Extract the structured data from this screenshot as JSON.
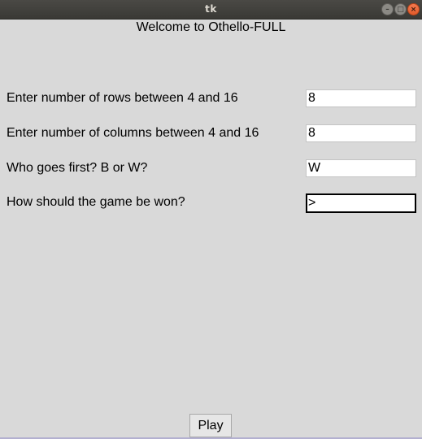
{
  "window": {
    "title": "tk",
    "controls": {
      "minimize_icon": "minimize-icon",
      "maximize_icon": "maximize-icon",
      "close_icon": "close-icon"
    }
  },
  "heading": "Welcome to Othello-FULL",
  "form": {
    "rows_label": "Enter number of rows between 4 and 16",
    "rows_value": "8",
    "columns_label": "Enter number of columns between 4 and 16",
    "columns_value": "8",
    "first_label": "Who goes first? B or W?",
    "first_value": "W",
    "win_label": "How should the game be won?",
    "win_value": ">"
  },
  "play_label": "Play",
  "colors": {
    "background": "#d9d9d9",
    "titlebar": "#3c3b37",
    "close_button": "#e95420"
  }
}
